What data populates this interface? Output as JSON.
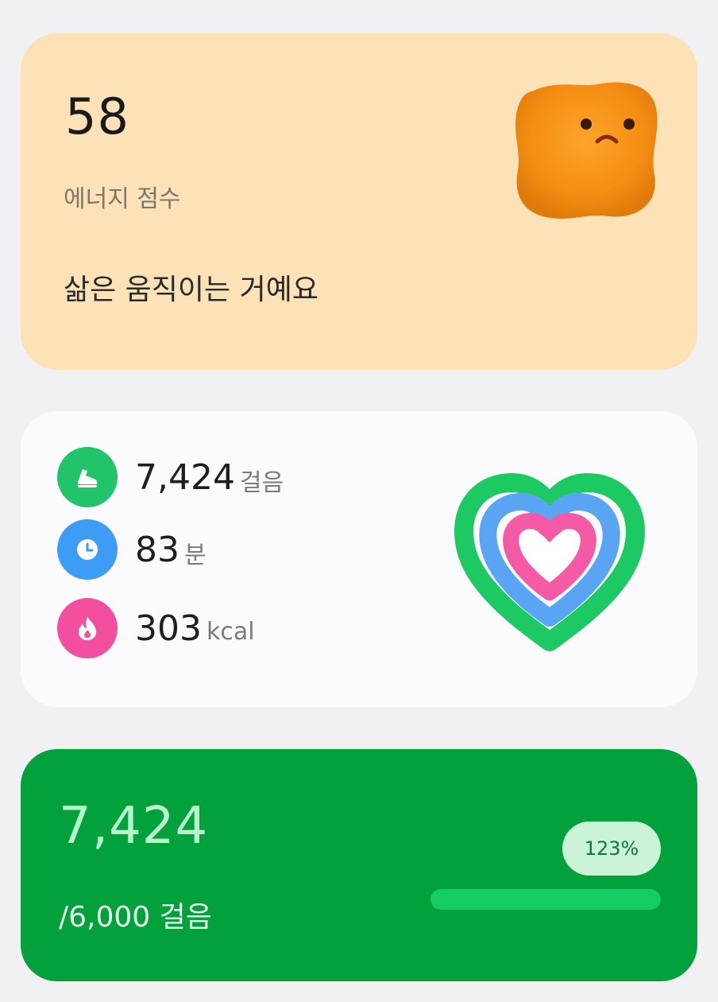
{
  "energy": {
    "score": "58",
    "label": "에너지 점수",
    "message": "삶은 움직이는 거예요",
    "colors": {
      "background": "#fde2b7",
      "mascot": "#f39016"
    },
    "mascot_icon": "fuzzy-orange-mascot"
  },
  "activity": {
    "steps": {
      "value": "7,424",
      "unit": "걸음",
      "icon": "shoe-icon",
      "color": "#22c46a"
    },
    "time": {
      "value": "83",
      "unit": "분",
      "icon": "clock-icon",
      "color": "#3d9cf5"
    },
    "calories": {
      "value": "303",
      "unit": "kcal",
      "icon": "flame-icon",
      "color": "#f34fa0"
    },
    "rings": {
      "steps_progress": 1.0,
      "time_progress": 0.97,
      "calories_progress": 0.95
    }
  },
  "steps_goal": {
    "current": "7,424",
    "goal_text": "/6,000 걸음",
    "percent": "123%",
    "progress": 1.0,
    "colors": {
      "background": "#02a13c",
      "bar": "#14cd65"
    }
  }
}
